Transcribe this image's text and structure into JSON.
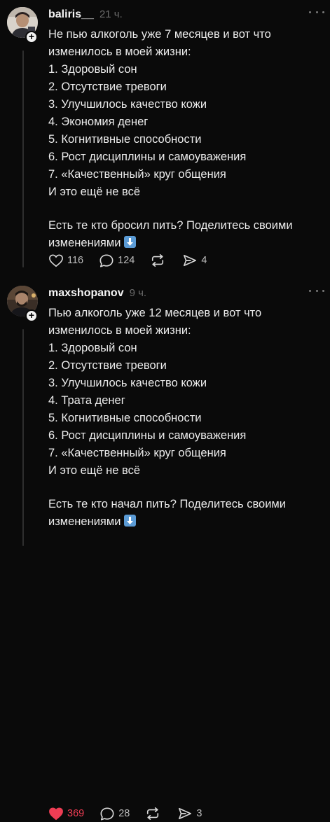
{
  "posts": [
    {
      "username": "baliris__",
      "time": "21 ч.",
      "lines": [
        "Не пью алкоголь уже 7 месяцев и вот что",
        "изменилось в моей жизни:",
        "1. Здоровый сон",
        "2. Отсутствие тревоги",
        "3. Улучшилось качество кожи",
        "4. Экономия денег",
        "5. Когнитивные способности",
        "6. Рост дисциплины и самоуважения",
        "7. «Качественный» круг общения",
        "И это ещё не всё"
      ],
      "question_line1": "Есть те кто бросил пить? Поделитесь своими",
      "question_line2": "изменениями",
      "likes": "116",
      "comments": "124",
      "shares": "4",
      "liked": false
    },
    {
      "username": "maxshopanov",
      "time": "9 ч.",
      "lines": [
        "Пью алкоголь уже 12 месяцев и вот что",
        "изменилось в моей жизни:",
        "1. Здоровый сон",
        "2. Отсутствие тревоги",
        "3. Улучшилось качество кожи",
        "4. Трата денег",
        "5. Когнитивные способности",
        "6. Рост дисциплины и самоуважения",
        "7. «Качественный» круг общения",
        "И это ещё не всё"
      ],
      "question_line1": "Есть те кто начал пить? Поделитесь своими",
      "question_line2": "изменениями",
      "likes": "369",
      "comments": "28",
      "shares": "3",
      "liked": true
    }
  ],
  "colors": {
    "background": "#0a0a0a",
    "like_active": "#ee3d54",
    "emoji_blue": "#5b9bd5"
  },
  "icons": {
    "like": "heart-icon",
    "comment": "comment-bubble-icon",
    "repost": "repost-icon",
    "share": "send-icon",
    "more": "more-dots-icon",
    "follow": "plus-icon",
    "emoji": "down-arrow-emoji"
  }
}
